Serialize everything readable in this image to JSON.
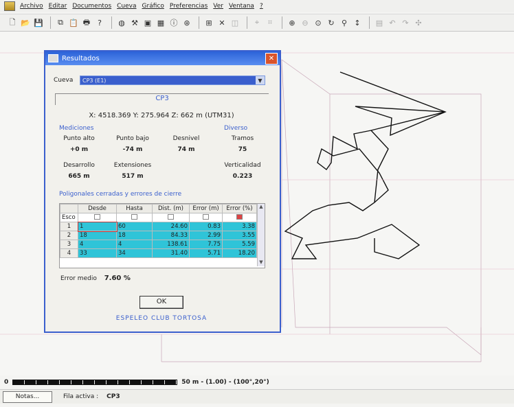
{
  "menu": [
    "Archivo",
    "Editar",
    "Documentos",
    "Cueva",
    "Gráfico",
    "Preferencias",
    "Ver",
    "Ventana",
    "?"
  ],
  "toolbar": [
    "new-icon",
    "open-icon",
    "save-icon",
    "copy-icon",
    "paste-icon",
    "print-icon",
    "help-icon",
    "globe-icon",
    "tools-icon",
    "camera-icon",
    "calculator-icon",
    "info-icon",
    "compass-icon",
    "grid-icon",
    "cross-icon",
    "layers-icon",
    "zoom-in-icon",
    "zoom-out-icon",
    "zoom-fit-icon",
    "rotate-icon",
    "pin-icon",
    "vertical-arrow-icon"
  ],
  "dialog": {
    "title": "Resultados",
    "cave_label": "Cueva",
    "cave_value": "CP3 (E1)",
    "cave_name": "CP3",
    "coords": "X: 4518.369  Y: 275.964  Z: 662 m  (UTM31)",
    "mediciones": "Mediciones",
    "diverso": "Diverso",
    "stats": [
      {
        "label": "Punto alto",
        "value": "+0 m"
      },
      {
        "label": "Punto bajo",
        "value": "-74 m"
      },
      {
        "label": "Desnivel",
        "value": "74 m"
      },
      {
        "label": "Tramos",
        "value": "75"
      },
      {
        "label": "Desarrollo",
        "value": "665 m"
      },
      {
        "label": "Extensiones",
        "value": "517 m"
      },
      {
        "label": "Verticalidad",
        "value": "0.223"
      }
    ],
    "poligonales": "Poligonales cerradas y errores de cierre",
    "table": {
      "headers": [
        "Esco",
        "Desde",
        "Hasta",
        "Dist. (m)",
        "Error (m)",
        "Error (%)"
      ],
      "rows": [
        [
          "1",
          "1",
          "60",
          "24.60",
          "0.83",
          "3.38"
        ],
        [
          "2",
          "18",
          "18",
          "84.33",
          "2.99",
          "3.55"
        ],
        [
          "3",
          "4",
          "4",
          "138.61",
          "7.75",
          "5.59"
        ],
        [
          "4",
          "33",
          "34",
          "31.40",
          "5.71",
          "18.20"
        ]
      ]
    },
    "error_medio_label": "Error medio",
    "error_medio_value": "7.60 %",
    "ok": "OK",
    "club": "ESPELEO CLUB TORTOSA"
  },
  "scale": {
    "zero": "0",
    "text": "50 m - (1.00) - (100°,20°)"
  },
  "status": {
    "notes": "Notas...",
    "fila_label": "Fila activa :",
    "fila_value": "CP3"
  },
  "colors": {
    "accent": "#3a5fcd",
    "row_highlight": "#2fc4d8",
    "plot_line": "#111111"
  }
}
